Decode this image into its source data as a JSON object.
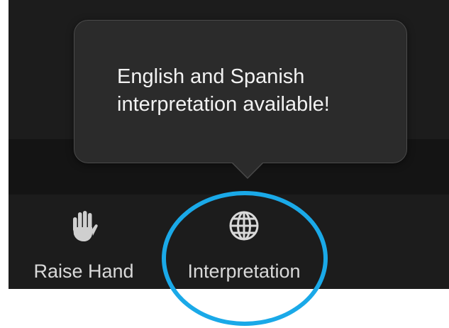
{
  "tooltip": {
    "line1": "English and Spanish",
    "line2": "interpretation available!"
  },
  "toolbar": {
    "raise_hand": {
      "label": "Raise Hand",
      "icon": "hand-icon"
    },
    "interpretation": {
      "label": "Interpretation",
      "icon": "globe-icon"
    }
  },
  "colors": {
    "toolbar_background": "#1c1c1c",
    "tooltip_background": "#2b2b2b",
    "text": "#d9d9d9",
    "highlight_ring": "#1aa9e8"
  }
}
